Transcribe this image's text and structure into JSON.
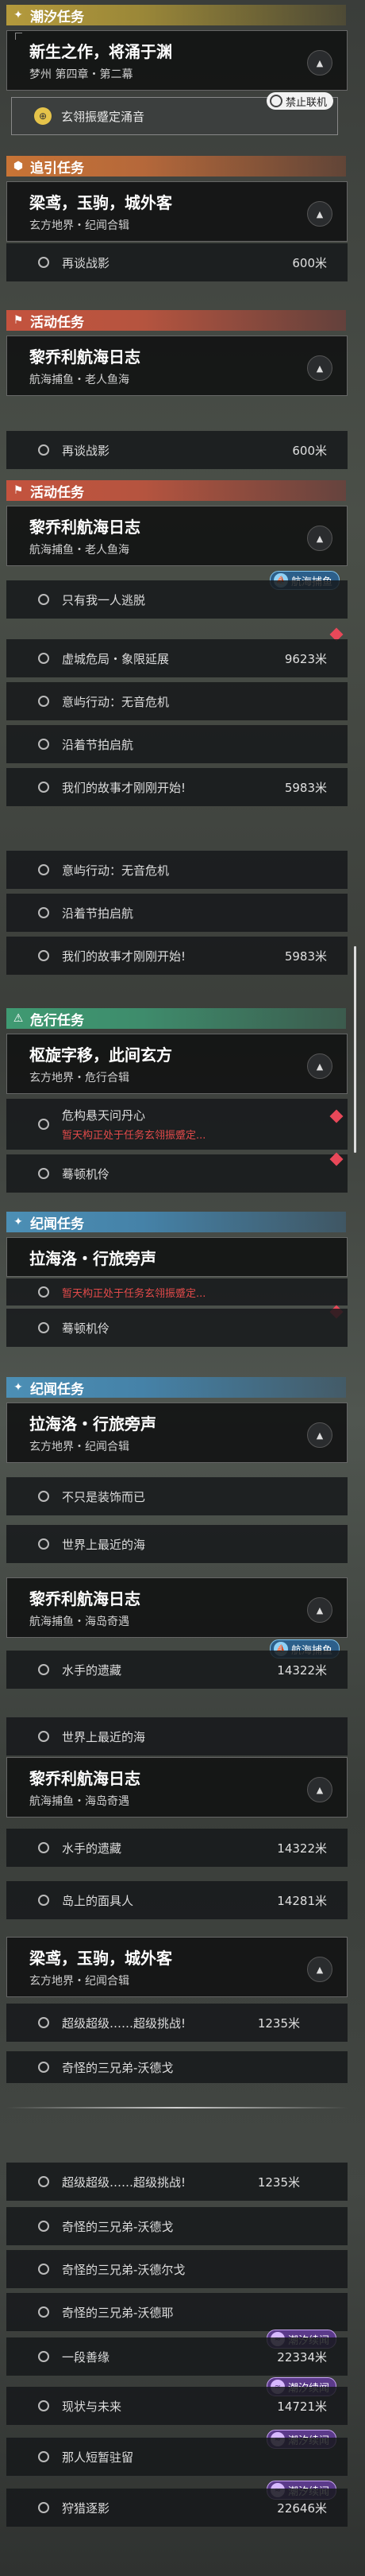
{
  "sec1": {
    "cat": "潮汐任务",
    "title": "新生之作，将涌于渊",
    "sub": "梦州  第四章・第二幕",
    "special": "玄翎振蹙定涌音",
    "ban": "禁止联机"
  },
  "sec2": {
    "cat": "追引任务",
    "title": "梁鸢，玉驹，城外客",
    "sub": "玄方地界・纪闻合辑",
    "rows": [
      {
        "label": "再谈战影",
        "dist": "600米"
      }
    ]
  },
  "sec3": {
    "cat": "活动任务",
    "title": "黎乔利航海日志",
    "sub": "航海捕鱼・老人鱼海"
  },
  "sec3b": {
    "rows": [
      {
        "label": "再谈战影",
        "dist": "600米"
      }
    ]
  },
  "sec4": {
    "cat": "活动任务",
    "title": "黎乔利航海日志",
    "sub": "航海捕鱼・老人鱼海",
    "badge": "航海捕鱼",
    "rows": [
      {
        "label": "只有我一人逃脱",
        "dist": ""
      },
      {
        "label": "虚城危局・象限延展",
        "dist": "9623米"
      },
      {
        "label": "意屿行动：无音危机",
        "dist": ""
      },
      {
        "label": "沿着节拍启航",
        "dist": ""
      },
      {
        "label": "我们的故事才刚刚开始!",
        "dist": "5983米"
      }
    ]
  },
  "sec4b": {
    "rows": [
      {
        "label": "意屿行动：无音危机",
        "dist": ""
      },
      {
        "label": "沿着节拍启航",
        "dist": ""
      },
      {
        "label": "我们的故事才刚刚开始!",
        "dist": "5983米"
      }
    ]
  },
  "sec5": {
    "cat": "危行任务",
    "title": "枢旋字移，此间玄方",
    "sub": "玄方地界・危行合辑",
    "rows": [
      {
        "label": "危构悬天问丹心",
        "warn": "暂天构正处于任务玄翎振蹙定..."
      },
      {
        "label": "蓦顿机伶",
        "warn": ""
      }
    ]
  },
  "sec6": {
    "cat": "纪闻任务",
    "title": "拉海洛・行旅旁声",
    "warn": "暂天构正处于任务玄翎振蹙定...",
    "rows": [
      {
        "label": "蓦顿机伶"
      }
    ]
  },
  "sec7": {
    "cat": "纪闻任务",
    "title": "拉海洛・行旅旁声",
    "sub": "玄方地界・纪闻合辑",
    "rows": [
      {
        "label": "不只是装饰而已",
        "dist": ""
      },
      {
        "label": "世界上最近的海",
        "dist": ""
      }
    ]
  },
  "sec8": {
    "title": "黎乔利航海日志",
    "sub": "航海捕鱼・海岛奇遇",
    "badge": "航海捕鱼",
    "rows": [
      {
        "label": "水手的遗藏",
        "dist": "14322米"
      }
    ]
  },
  "sec8b": {
    "rows": [
      {
        "label": "世界上最近的海",
        "dist": ""
      }
    ]
  },
  "sec9": {
    "title": "黎乔利航海日志",
    "sub": "航海捕鱼・海岛奇遇",
    "rows": [
      {
        "label": "水手的遗藏",
        "dist": "14322米"
      },
      {
        "label": "岛上的面具人",
        "dist": "14281米"
      }
    ]
  },
  "sec10": {
    "title": "梁鸢，玉驹，城外客",
    "sub": "玄方地界・纪闻合辑",
    "rows": [
      {
        "label": "超级超级……超级挑战!",
        "dist": "1235米"
      },
      {
        "label": "奇怪的三兄弟-沃德戈",
        "dist": ""
      }
    ]
  },
  "sec11": {
    "rows": [
      {
        "label": "超级超级……超级挑战!",
        "dist": "1235米"
      },
      {
        "label": "奇怪的三兄弟-沃德戈",
        "dist": ""
      },
      {
        "label": "奇怪的三兄弟-沃德尔戈",
        "dist": ""
      },
      {
        "label": "奇怪的三兄弟-沃德耶",
        "dist": ""
      },
      {
        "label": "一段善缘",
        "dist": "22334米"
      },
      {
        "label": "现状与未来",
        "dist": "14721米"
      },
      {
        "label": "那人短暂驻留",
        "dist": ""
      },
      {
        "label": "狩猎逐影",
        "dist": "22646米"
      }
    ],
    "badge": "潮汐续闻"
  }
}
